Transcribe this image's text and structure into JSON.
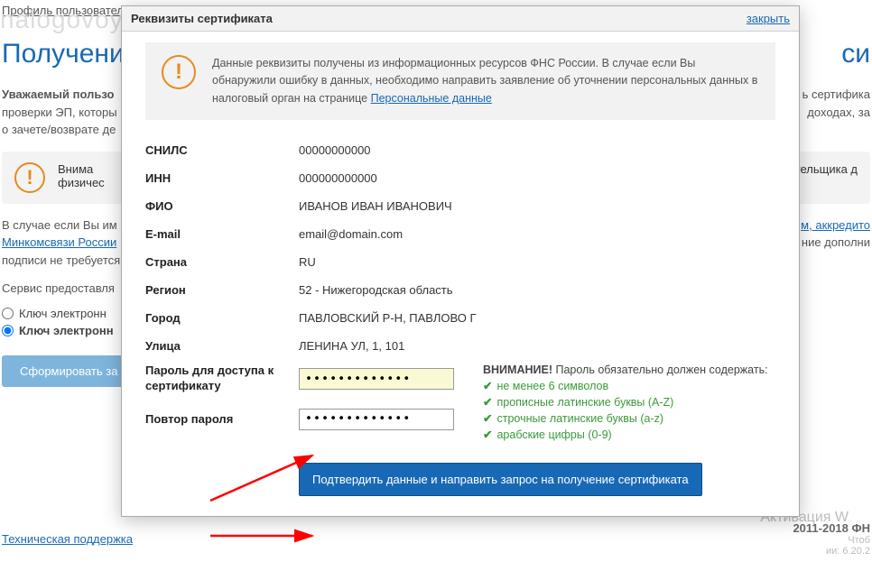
{
  "background": {
    "profile_link": "Профиль пользователя",
    "watermark": "nalogovoy.net",
    "page_title": "Получени",
    "page_title_right": "си",
    "greeting_bold": "Уважаемый пользо",
    "text_line1": "проверки ЭП, которы",
    "text_line2": "о зачете/возврате де",
    "text_right1": "ь сертифика",
    "text_right2": "доходах, за",
    "warn_title": "Внима",
    "warn_sub": "физичес",
    "warn_right": "лательщика д",
    "below1_pre": "В случае если Вы им",
    "below1_link": "м, аккредито",
    "below2_link": "Минкомсвязи России",
    "below2_post": "ние дополни",
    "below3": "подписи не требуется",
    "below4": "Сервис предоставля",
    "radio1": "Ключ электронн",
    "radio2": "Ключ электронн",
    "btn": "Сформировать за",
    "footer_link": "Техническая поддержка",
    "footer_right": "2011-2018 ФН",
    "footer_tiny1": "Чтоб",
    "footer_tiny2": "ии: 6.20.2",
    "activation": "Активация W"
  },
  "modal": {
    "title": "Реквизиты сертификата",
    "close": "закрыть",
    "info_text_pre": "Данные реквизиты получены из информационных ресурсов ФНС России. В случае если Вы обнаружили ошибку в данных, необходимо направить заявление об уточнении персональных данных в налоговый орган на странице ",
    "info_link": "Персональные данные",
    "fields": {
      "snils": {
        "label": "СНИЛС",
        "value": "00000000000"
      },
      "inn": {
        "label": "ИНН",
        "value": "000000000000"
      },
      "fio": {
        "label": "ФИО",
        "value": "ИВАНОВ ИВАН ИВАНОВИЧ"
      },
      "email": {
        "label": "E-mail",
        "value": "email@domain.com"
      },
      "country": {
        "label": "Страна",
        "value": "RU"
      },
      "region": {
        "label": "Регион",
        "value": "52 - Нижегородская область"
      },
      "city": {
        "label": "Город",
        "value": "ПАВЛОВСКИЙ Р-Н, ПАВЛОВО Г"
      },
      "street": {
        "label": "Улица",
        "value": "ЛЕНИНА УЛ, 1, 101"
      },
      "password": {
        "label": "Пароль для доступа к сертификату",
        "value": "•••••••••••••"
      },
      "password2": {
        "label": "Повтор пароля",
        "value": "•••••••••••••"
      }
    },
    "hints": {
      "title_bold": "ВНИМАНИЕ!",
      "title_rest": " Пароль обязательно должен содержать:",
      "h1": "не менее 6 символов",
      "h2": "прописные латинские буквы (A-Z)",
      "h3": "строчные латинские буквы (a-z)",
      "h4": "арабские цифры (0-9)"
    },
    "submit": "Подтвердить данные и направить запрос на получение сертификата"
  }
}
